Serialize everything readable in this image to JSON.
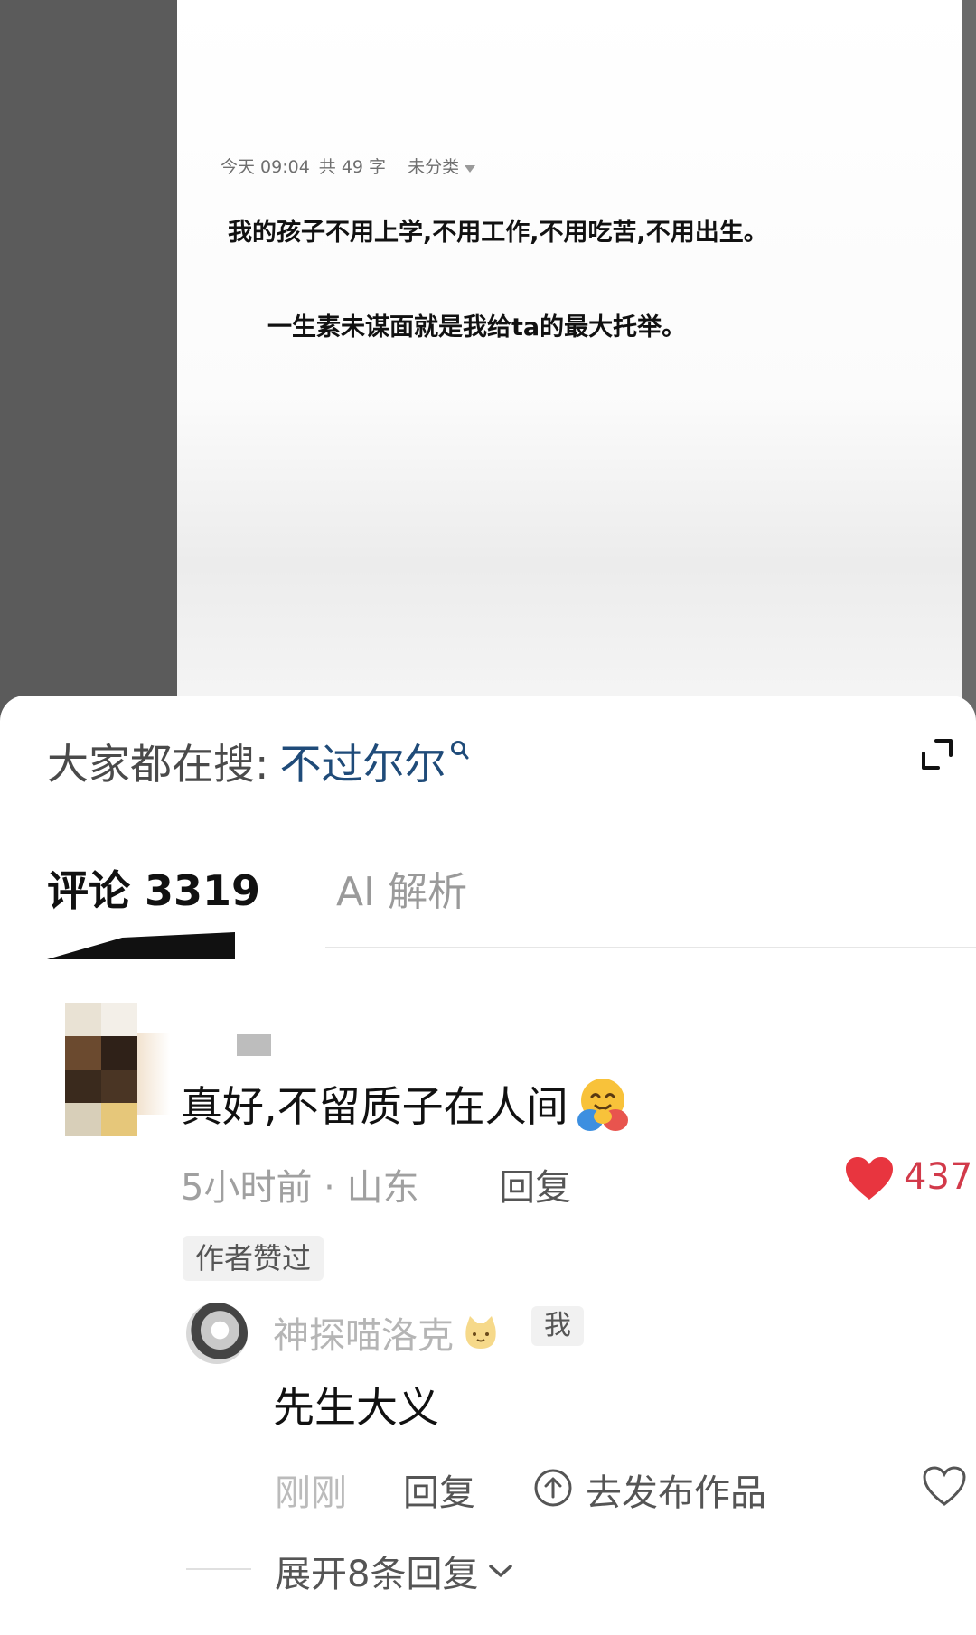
{
  "note": {
    "date": "今天 09:04",
    "word_count": "共 49 字",
    "category": "未分类",
    "line1": "我的孩子不用上学,不用工作,不用吃苦,不用出生。",
    "line2": "一生素未谋面就是我给ta的最大托举。"
  },
  "search_bar": {
    "prefix": "大家都在搜:",
    "term": "不过尔尔"
  },
  "tabs": {
    "comments": "评论 3319",
    "ai": "AI 解析"
  },
  "comment": {
    "text": "真好,不留质子在人间",
    "emoji": "smiling-face-with-hugging-hands",
    "time_location": "5小时前 · 山东",
    "reply_label": "回复",
    "likes": "437",
    "author_badge": "作者赞过"
  },
  "reply": {
    "username": "神探喵洛克",
    "me_badge": "我",
    "text": "先生大义",
    "time": "刚刚",
    "reply_label": "回复",
    "publish_label": "去发布作品"
  },
  "expand": {
    "label": "展开8条回复"
  },
  "colors": {
    "like_red": "#e8353f",
    "search_link": "#1f4b79"
  }
}
